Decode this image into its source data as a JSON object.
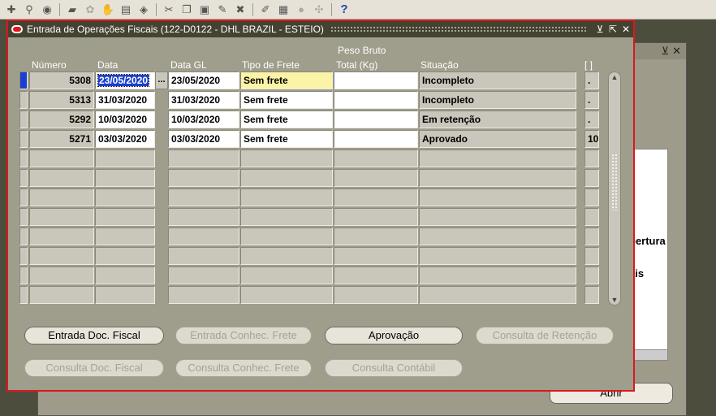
{
  "toolbar": {
    "icons": [
      "new-record-icon",
      "find-icon",
      "navigator-icon",
      "save-icon",
      "clear-icon",
      "transactions-icon",
      "print-icon",
      "attachments-icon",
      "cut-icon",
      "copy-icon",
      "paste-icon",
      "edit-field-icon",
      "delete-record-icon",
      "folder-icon",
      "translations-icon",
      "zoom-icon",
      "tools-icon",
      "help-icon"
    ],
    "help_glyph": "?"
  },
  "window": {
    "title": "Entrada de Operações Fiscais (122-D0122 - DHL BRAZIL - ESTEIO)",
    "controls": [
      "minimize-icon",
      "maximize-icon",
      "close-icon"
    ]
  },
  "columns": {
    "numero": "Número",
    "data": "Data",
    "data_gl": "Data GL",
    "tipo_frete": "Tipo de Frete",
    "peso_line1": "Peso Bruto",
    "peso_line2": "Total (Kg)",
    "situacao": "Situação",
    "extra": "[ ]"
  },
  "rows": [
    {
      "numero": "5308",
      "data": "23/05/2020",
      "data_gl": "23/05/2020",
      "tipo_frete": "Sem frete",
      "peso": "",
      "situacao": "Incompleto",
      "extra": "."
    },
    {
      "numero": "5313",
      "data": "31/03/2020",
      "data_gl": "31/03/2020",
      "tipo_frete": "Sem frete",
      "peso": "",
      "situacao": "Incompleto",
      "extra": "."
    },
    {
      "numero": "5292",
      "data": "10/03/2020",
      "data_gl": "10/03/2020",
      "tipo_frete": "Sem frete",
      "peso": "",
      "situacao": "Em retenção",
      "extra": "."
    },
    {
      "numero": "5271",
      "data": "03/03/2020",
      "data_gl": "03/03/2020",
      "tipo_frete": "Sem frete",
      "peso": "",
      "situacao": "Aprovado",
      "extra": "10"
    }
  ],
  "empty_rows": 8,
  "lov_glyph": "...",
  "buttons": {
    "entrada_doc": "Entrada Doc. Fiscal",
    "entrada_conhec": "Entrada Conhec. Frete",
    "aprovacao": "Aprovação",
    "consulta_retencao": "Consulta de Retenção",
    "consulta_doc": "Consulta Doc. Fiscal",
    "consulta_conhec": "Consulta Conhec. Frete",
    "consulta_contabil": "Consulta Contábil"
  },
  "background_window": {
    "label_1": "pertura",
    "label_2": "ais",
    "button": "Abrir"
  }
}
